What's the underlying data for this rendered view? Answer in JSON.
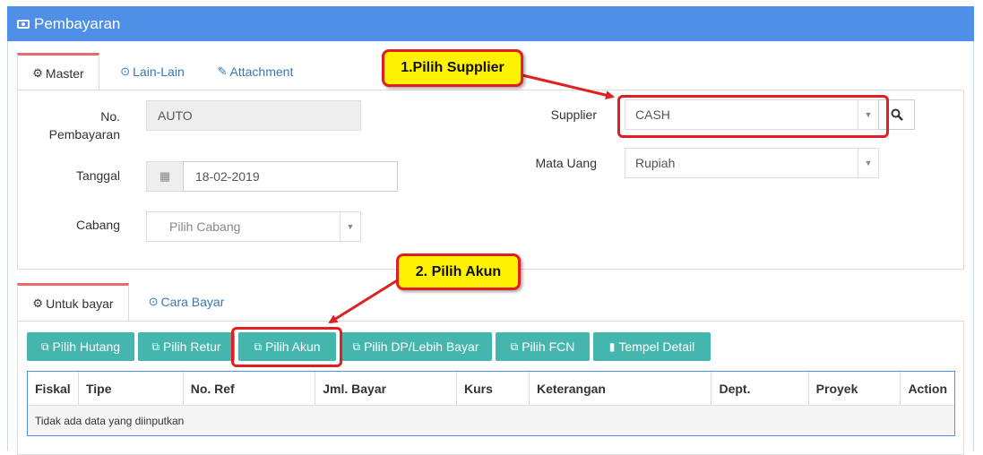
{
  "panel": {
    "title": "Pembayaran"
  },
  "tabs_top": [
    {
      "label": "Master",
      "icon": "gears-icon"
    },
    {
      "label": "Lain-Lain",
      "icon": "check-circle-icon"
    },
    {
      "label": "Attachment",
      "icon": "paperclip-icon"
    }
  ],
  "form": {
    "no_pembayaran_label": "No. Pembayaran",
    "no_pembayaran_value": "AUTO",
    "tanggal_label": "Tanggal",
    "tanggal_value": "18-02-2019",
    "cabang_label": "Cabang",
    "cabang_placeholder": "Pilih Cabang",
    "supplier_label": "Supplier",
    "supplier_value": "CASH",
    "mata_uang_label": "Mata Uang",
    "mata_uang_value": "Rupiah"
  },
  "tabs_bottom": [
    {
      "label": "Untuk bayar",
      "icon": "gears-icon"
    },
    {
      "label": "Cara Bayar",
      "icon": "check-circle-icon"
    }
  ],
  "buttons": [
    {
      "label": "Pilih Hutang",
      "icon": "copy-icon"
    },
    {
      "label": "Pilih Retur",
      "icon": "copy-icon"
    },
    {
      "label": "Pilih Akun",
      "icon": "copy-icon"
    },
    {
      "label": "Pilih DP/Lebih Bayar",
      "icon": "copy-icon"
    },
    {
      "label": "Pilih FCN",
      "icon": "copy-icon"
    },
    {
      "label": "Tempel Detail",
      "icon": "paste-icon"
    }
  ],
  "table": {
    "columns": [
      "Fiskal",
      "Tipe",
      "No. Ref",
      "Jml. Bayar",
      "Kurs",
      "Keterangan",
      "Dept.",
      "Proyek",
      "Action"
    ],
    "empty_text": "Tidak ada data yang diinputkan"
  },
  "annotations": {
    "callout1": "1.Pilih Supplier",
    "callout2": "2. Pilih Akun",
    "color": "#e02020",
    "fill": "#fff200"
  },
  "colors": {
    "header": "#4f8fe8",
    "button": "#45b6ae",
    "active_tab_border": "#e8696b",
    "link": "#337ab7"
  }
}
